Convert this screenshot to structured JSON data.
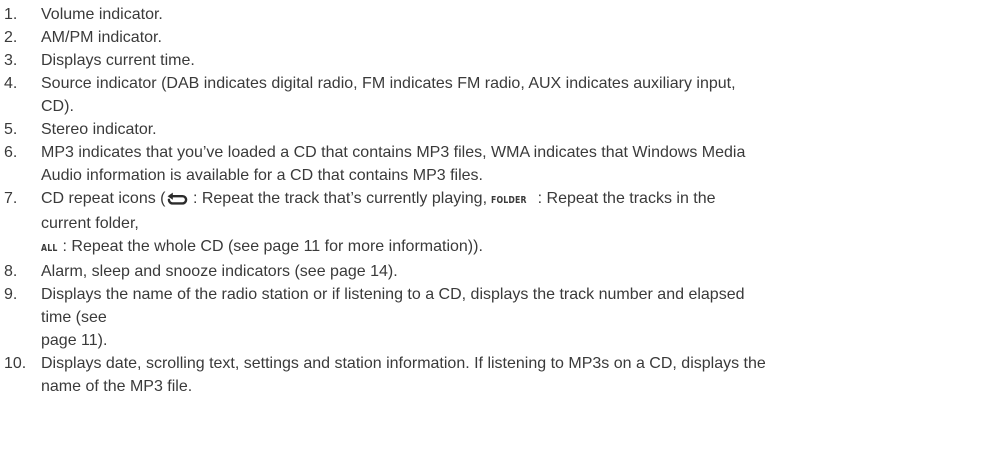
{
  "items": [
    {
      "num": "1.",
      "lines": [
        "Volume indicator."
      ]
    },
    {
      "num": "2.",
      "lines": [
        "AM/PM indicator."
      ]
    },
    {
      "num": "3.",
      "lines": [
        "Displays current time."
      ]
    },
    {
      "num": "4.",
      "lines": [
        "Source indicator (DAB indicates digital radio, FM indicates FM radio, AUX indicates auxiliary input,",
        "CD)."
      ]
    },
    {
      "num": "5.",
      "lines": [
        "Stereo indicator."
      ]
    },
    {
      "num": "6.",
      "lines": [
        "MP3 indicates that you’ve loaded a CD that contains MP3 files, WMA indicates that Windows Media",
        "Audio information is available for a CD that contains MP3 files."
      ]
    },
    {
      "num": "7.",
      "line1_pre": "CD repeat icons (",
      "repeat_icon": "repeat-icon",
      "line1_mid": " : Repeat the track that’s currently playing, ",
      "folder_label": "FOLDER",
      "line1_post": " : Repeat the tracks in the",
      "line2": "current folder,",
      "all_label": "ALL",
      "line3_post": " : Repeat the whole CD (see page 11 for more information))."
    },
    {
      "num": "8.",
      "lines": [
        "Alarm, sleep and snooze indicators (see page 14)."
      ]
    },
    {
      "num": "9.",
      "lines": [
        "Displays the name of the radio station or if listening to a CD, displays the track number and elapsed",
        "time (see",
        "page 11)."
      ]
    },
    {
      "num": "10.",
      "lines": [
        "Displays date, scrolling text, settings and station information. If listening to MP3s on a CD, displays the",
        "name of the MP3 file."
      ]
    }
  ]
}
